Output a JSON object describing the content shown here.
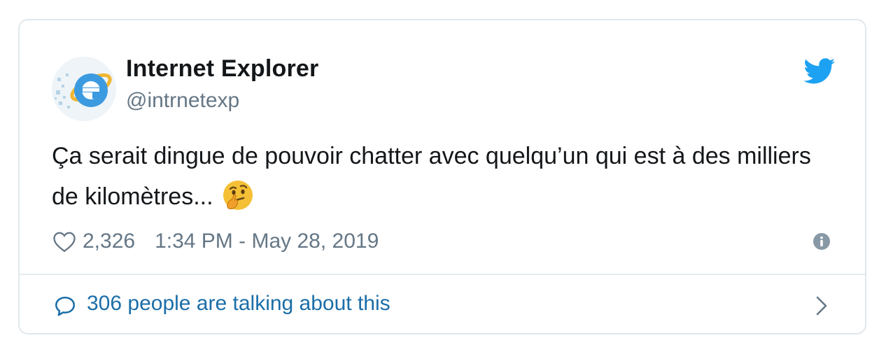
{
  "tweet": {
    "display_name": "Internet Explorer",
    "handle": "@intrnetexp",
    "text": "Ça serait dingue de pouvoir chatter avec quelqu’un qui est à des milliers de kilomètres...",
    "emoji": "thinking-face",
    "like_count": "2,326",
    "timestamp": "1:34 PM - May 28, 2019",
    "conversation_label": "306 people are talking about this"
  },
  "icons": {
    "brand": "twitter-bird",
    "like": "heart-outline",
    "info": "info-circle",
    "conversation": "speech-bubble",
    "open": "chevron-right"
  },
  "colors": {
    "twitter_blue": "#1da1f2",
    "link": "#1b6ea8",
    "text": "#14171a",
    "secondary": "#657786",
    "border": "#e1e8ed"
  }
}
